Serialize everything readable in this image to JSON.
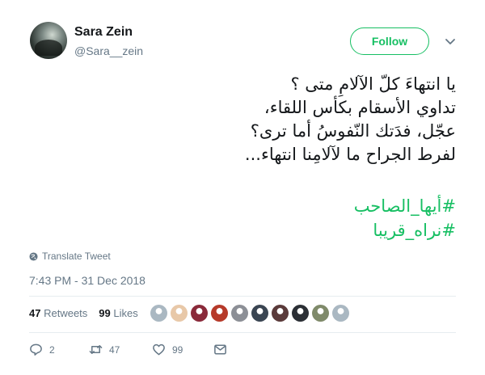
{
  "user": {
    "display_name": "Sara Zein",
    "handle": "@Sara__zein",
    "avatar_icon": "profile-photo-avatar"
  },
  "header": {
    "follow_label": "Follow",
    "caret_icon": "chevron-down-icon"
  },
  "tweet": {
    "lines": [
      "يا انتهاءَ كلّ الآلامِ متى ؟",
      "تداوي الأسقام بكأس اللقاء،",
      "عجّل، فدَتك النّفوسُ أما ترى؟",
      "لفرط الجراح ما لآلامِنا انتهاء..."
    ],
    "hashtags": [
      "#أيها_الصاحب",
      "#نراه_قريبا"
    ]
  },
  "translate": {
    "label": "Translate Tweet",
    "icon": "globe-icon"
  },
  "timestamp": "7:43 PM - 31 Dec 2018",
  "stats": {
    "retweets_count": "47",
    "retweets_label": "Retweets",
    "likes_count": "99",
    "likes_label": "Likes"
  },
  "likers": [
    {
      "color": "#aab8c2"
    },
    {
      "color": "#e8c8a8"
    },
    {
      "color": "#8a2a3a"
    },
    {
      "color": "#b63a2a"
    },
    {
      "color": "#8c8f96"
    },
    {
      "color": "#3a4552"
    },
    {
      "color": "#5a3a3a"
    },
    {
      "color": "#2b2f35"
    },
    {
      "color": "#7f8a6a"
    },
    {
      "color": "#aab8c2"
    }
  ],
  "actions": {
    "reply_count": "2",
    "retweet_count": "47",
    "like_count": "99",
    "reply_icon": "reply-icon",
    "retweet_icon": "retweet-icon",
    "like_icon": "heart-icon",
    "dm_icon": "envelope-icon"
  },
  "colors": {
    "accent": "#17bf63",
    "muted": "#657786",
    "text": "#14171a",
    "divider": "#e6ecf0"
  }
}
